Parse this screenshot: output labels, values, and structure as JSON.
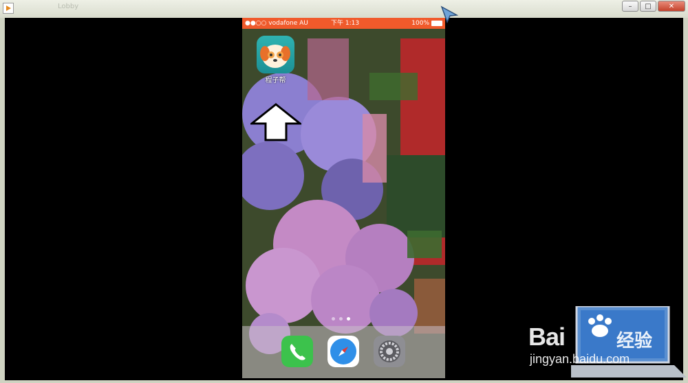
{
  "window": {
    "ghost_title": "Lobby",
    "buttons": {
      "minimize": "–",
      "maximize": "□",
      "close": "✕"
    }
  },
  "phone": {
    "status": {
      "carrier": "●●○○ vodafone AU",
      "time": "下午 1:13",
      "battery": "100%"
    },
    "app": {
      "label": "程子帮",
      "icon": "dog-face-icon"
    },
    "dock": [
      "phone-icon",
      "safari-icon",
      "settings-icon"
    ],
    "colors": {
      "status_bar": "#f05a2b"
    }
  },
  "watermark": {
    "brand": "Bai",
    "product": "经验",
    "url": "jingyan.baidu.com"
  }
}
